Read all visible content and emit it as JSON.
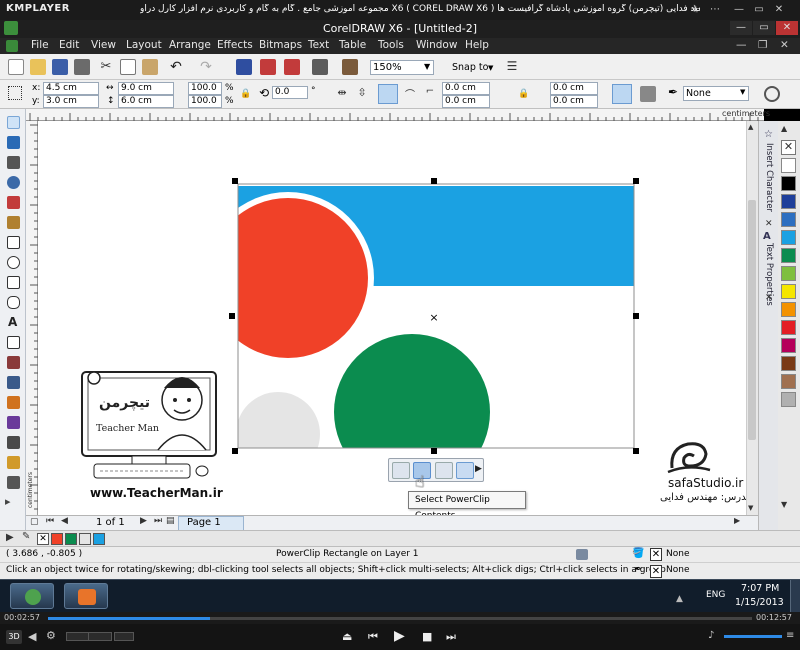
{
  "player": {
    "logo": "KMPLAYER",
    "title": "مجموعه آموزشی جامع . گام به گام و کاربردی نرم افزار کارل دراو X6 ( COREL DRAW X6 )   مدرس : سعید فدایی (تیچرمن) گروه آموزشی پادشاه گرافیست ها",
    "time_elapsed": "00:02:57",
    "time_total": "00:12:57",
    "mode_3d": "3D",
    "seek_progress": 0.23
  },
  "window": {
    "title": "CorelDRAW X6 - [Untitled-2]",
    "menu": [
      "File",
      "Edit",
      "View",
      "Layout",
      "Arrange",
      "Effects",
      "Bitmaps",
      "Text",
      "Table",
      "Tools",
      "Window",
      "Help"
    ]
  },
  "toolbar": {
    "zoom": "150%",
    "snap_to": "Snap to"
  },
  "propbar": {
    "x_label": "x:",
    "x": "4.5 cm",
    "y_label": "y:",
    "y": "3.0 cm",
    "w": "9.0 cm",
    "h": "6.0 cm",
    "scale_w": "100.0",
    "scale_h": "100.0",
    "scale_unit": "%",
    "rotation": "0.0",
    "rotation_unit": "°",
    "corner_top_left": "0.0 cm",
    "corner_bottom_left": "0.0 cm",
    "corner_top_right": "0.0 cm",
    "corner_bottom_right": "0.0 cm",
    "outline": "None"
  },
  "rulers": {
    "unit": "centimeters",
    "vertical_label": "centimeters"
  },
  "dockers": {
    "tab1": "Insert Character",
    "tab2": "Text Properties"
  },
  "canvas": {
    "colors": {
      "blue_rect": "#1ba1e2",
      "red_circle": "#f04128",
      "green_circle": "#0b8c4f",
      "gray_circle": "#e5e5e5"
    }
  },
  "powerclip_tooltip": "Select PowerClip Contents",
  "watermark": {
    "teacher_brand_fa": "تیچرمن",
    "teacher_brand_en": "Teacher Man",
    "teacher_site": "www.TeacherMan.ir",
    "studio_site": "safaStudio.ir",
    "studio_credit": "مدرس: مهندس فدایی"
  },
  "navigation": {
    "page_counter": "1 of 1",
    "page_tab": "Page 1"
  },
  "document_palette": [
    "#f04128",
    "#0b8c4f",
    "#e5e5e5",
    "#1ba1e2"
  ],
  "status": {
    "coords": "( 3.686 , -0.805 )",
    "selection": "PowerClip Rectangle on Layer 1",
    "fill": "None",
    "outline": "None",
    "hint": "Click an object twice for rotating/skewing; dbl-clicking tool selects all objects; Shift+click multi-selects; Alt+click digs; Ctrl+click selects in a group"
  },
  "palette_colors": [
    "#ffffff",
    "#000000",
    "#1f3f9a",
    "#2d6fc0",
    "#1ba1e2",
    "#0b8c4f",
    "#7fbf3f",
    "#f5e600",
    "#f39200",
    "#e31e24",
    "#b5005b",
    "#7a3a16",
    "#a07050",
    "#b0b0b0"
  ],
  "taskbar": {
    "language": "ENG",
    "time": "7:07 PM",
    "date": "1/15/2013"
  }
}
